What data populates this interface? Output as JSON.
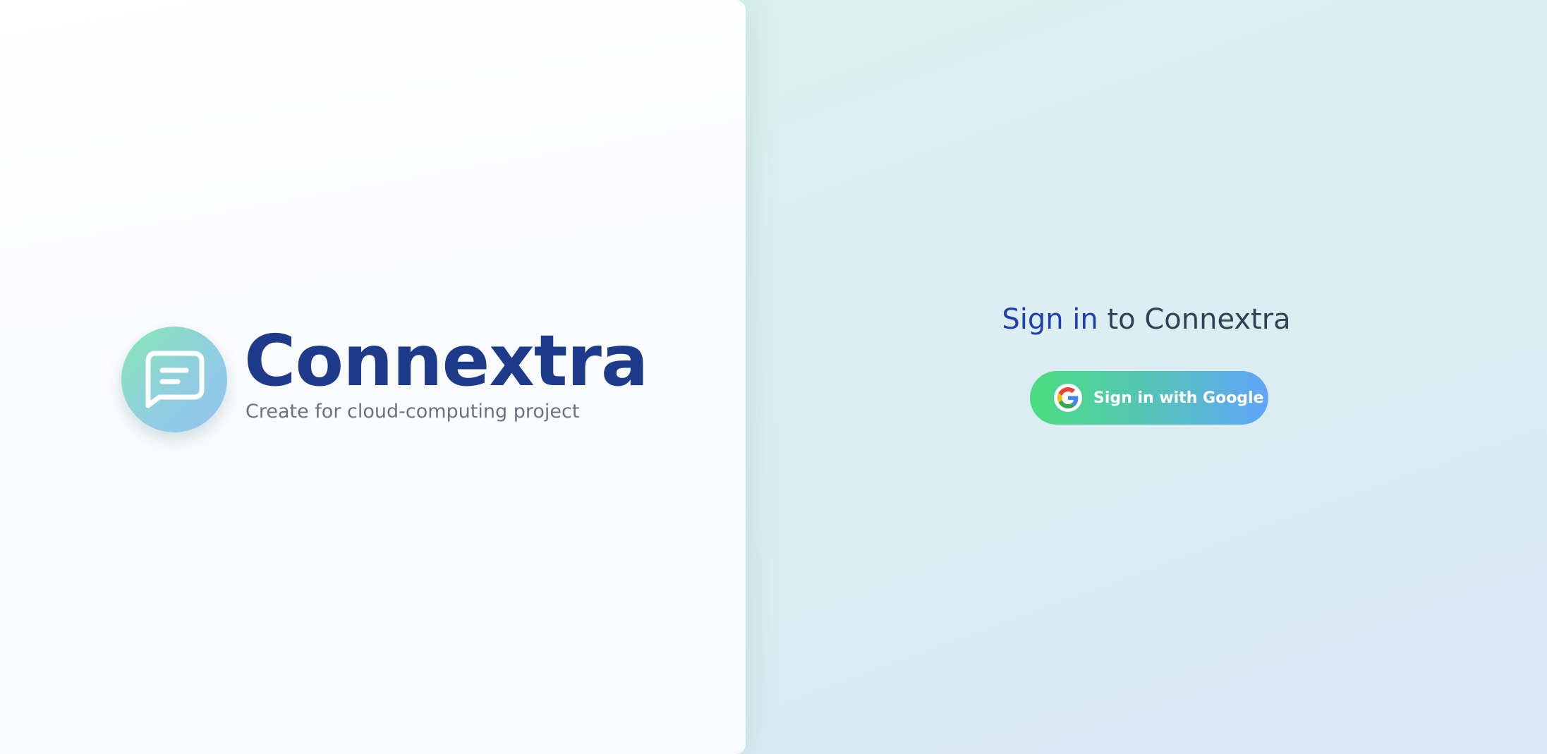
{
  "brand": {
    "name": "Connextra",
    "tagline": "Create for cloud-computing project",
    "logo_icon": "chat-message-icon"
  },
  "signin": {
    "title_accent": "Sign in",
    "title_rest": " to Connextra",
    "google_button_label": "Sign in with Google",
    "google_icon": "google-g-icon"
  },
  "colors": {
    "brand_primary": "#1e3a8a",
    "title_accent": "#1e40af",
    "button_gradient_start": "#4ade80",
    "button_gradient_end": "#60a5fa",
    "logo_gradient_start": "#86eab1",
    "logo_gradient_end": "#93c2f5"
  }
}
